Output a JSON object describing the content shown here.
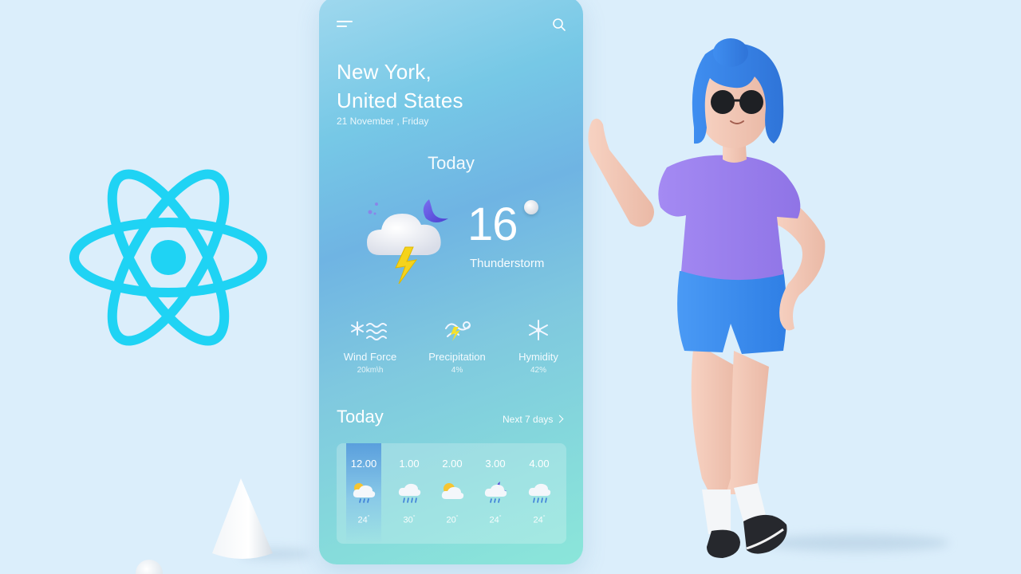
{
  "weather": {
    "city_line1": "New York,",
    "city_line2": "United States",
    "date": "21 November , Friday",
    "heading": "Today",
    "temperature": "16",
    "condition": "Thunderstorm"
  },
  "stats": [
    {
      "label": "Wind Force",
      "value": "20km\\h",
      "icon": "wind-icon"
    },
    {
      "label": "Precipitation",
      "value": "4%",
      "icon": "precipitation-icon"
    },
    {
      "label": "Hymidity",
      "value": "42%",
      "icon": "humidity-icon"
    }
  ],
  "forecast": {
    "title": "Today",
    "next_link": "Next 7 days",
    "hours": [
      {
        "time": "12.00",
        "temp": "24",
        "icon": "sun-rain-icon",
        "active": true
      },
      {
        "time": "1.00",
        "temp": "30",
        "icon": "rain-cloud-icon",
        "active": false
      },
      {
        "time": "2.00",
        "temp": "20",
        "icon": "partly-cloudy-icon",
        "active": false
      },
      {
        "time": "3.00",
        "temp": "24",
        "icon": "moon-rain-icon",
        "active": false
      },
      {
        "time": "4.00",
        "temp": "24",
        "icon": "rain-cloud-icon",
        "active": false
      }
    ]
  },
  "colors": {
    "background": "#dbeefb",
    "react_accent": "#1fd3f4",
    "active_hour": "#5a9fdd"
  }
}
